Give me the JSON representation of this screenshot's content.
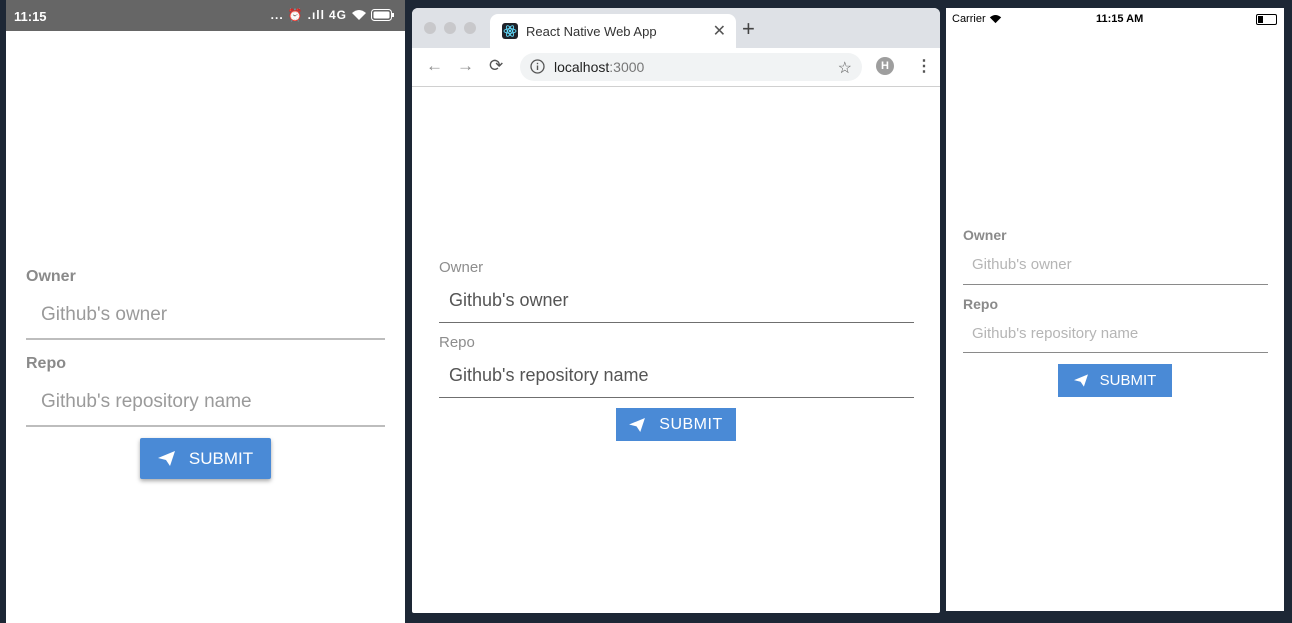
{
  "colors": {
    "accent": "#4a8ad6",
    "android_statusbar": "#666666",
    "background": "#1d2735"
  },
  "android": {
    "status_time": "11:15",
    "status_icons": [
      "...",
      "alarm-icon",
      ".ıll",
      "4G",
      "wifi-icon",
      "battery-icon"
    ],
    "network": "4G",
    "owner_label": "Owner",
    "owner_placeholder": "Github's owner",
    "repo_label": "Repo",
    "repo_placeholder": "Github's repository name",
    "submit_label": "SUBMIT"
  },
  "chrome": {
    "tab_title": "React Native Web App",
    "url_host": "localhost",
    "url_port": ":3000",
    "avatar_letter": "H",
    "owner_label": "Owner",
    "owner_placeholder": "Github's owner",
    "repo_label": "Repo",
    "repo_placeholder": "Github's repository name",
    "submit_label": "SUBMIT"
  },
  "ios": {
    "carrier": "Carrier",
    "status_time": "11:15 AM",
    "owner_label": "Owner",
    "owner_placeholder": "Github's owner",
    "repo_label": "Repo",
    "repo_placeholder": "Github's repository name",
    "submit_label": "SUBMIT"
  }
}
